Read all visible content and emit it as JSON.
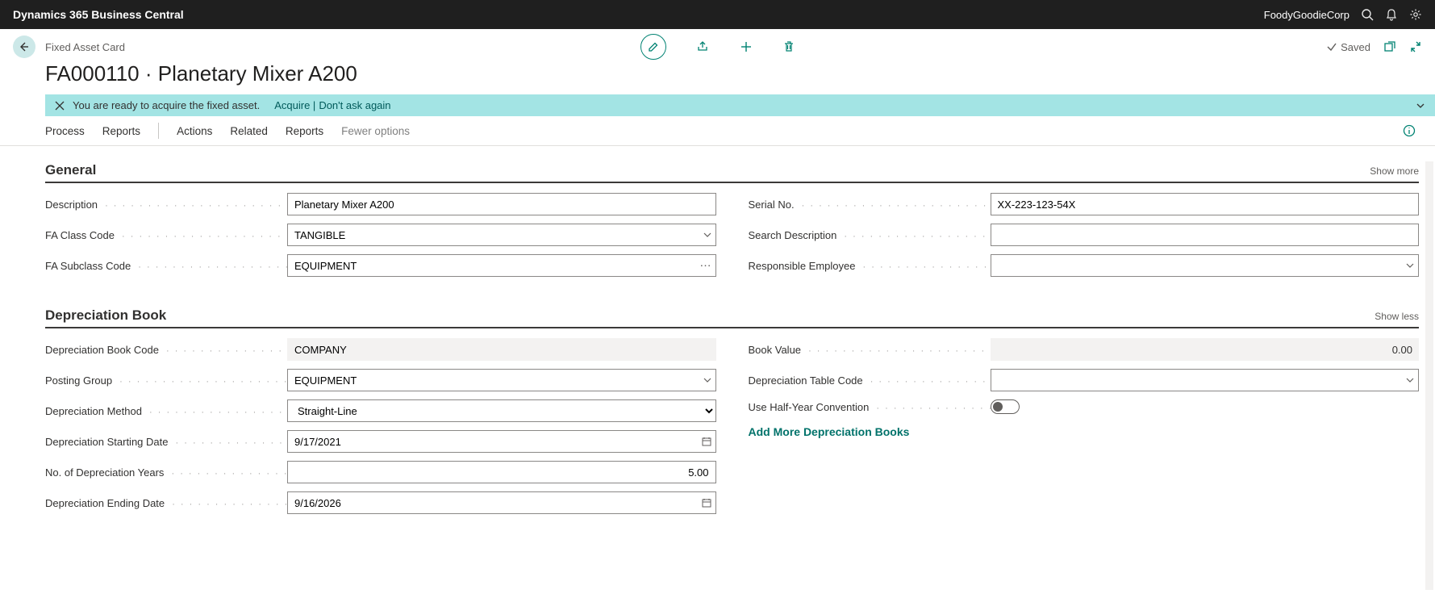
{
  "topbar": {
    "product": "Dynamics 365 Business Central",
    "company": "FoodyGoodieCorp"
  },
  "breadcrumb": "Fixed Asset Card",
  "saved_label": "Saved",
  "page_title": "FA000110 · Planetary Mixer A200",
  "notification": {
    "message": "You are ready to acquire the fixed asset.",
    "action1": "Acquire",
    "action2": "Don't ask again"
  },
  "toolbar": {
    "items": [
      "Process",
      "Reports"
    ],
    "items2": [
      "Actions",
      "Related",
      "Reports"
    ],
    "fewer": "Fewer options"
  },
  "sections": {
    "general": {
      "title": "General",
      "toggle": "Show more",
      "fields": {
        "description": {
          "label": "Description",
          "value": "Planetary Mixer A200"
        },
        "fa_class_code": {
          "label": "FA Class Code",
          "value": "TANGIBLE"
        },
        "fa_subclass_code": {
          "label": "FA Subclass Code",
          "value": "EQUIPMENT"
        },
        "serial_no": {
          "label": "Serial No.",
          "value": "XX-223-123-54X"
        },
        "search_description": {
          "label": "Search Description",
          "value": ""
        },
        "responsible_employee": {
          "label": "Responsible Employee",
          "value": ""
        }
      }
    },
    "depreciation": {
      "title": "Depreciation Book",
      "toggle": "Show less",
      "fields": {
        "depr_book_code": {
          "label": "Depreciation Book Code",
          "value": "COMPANY"
        },
        "posting_group": {
          "label": "Posting Group",
          "value": "EQUIPMENT"
        },
        "depr_method": {
          "label": "Depreciation Method",
          "value": "Straight-Line"
        },
        "depr_start_date": {
          "label": "Depreciation Starting Date",
          "value": "9/17/2021"
        },
        "no_depr_years": {
          "label": "No. of Depreciation Years",
          "value": "5.00"
        },
        "depr_end_date": {
          "label": "Depreciation Ending Date",
          "value": "9/16/2026"
        },
        "book_value": {
          "label": "Book Value",
          "value": "0.00"
        },
        "depr_table_code": {
          "label": "Depreciation Table Code",
          "value": ""
        },
        "half_year": {
          "label": "Use Half-Year Convention",
          "on": false
        }
      },
      "add_more": "Add More Depreciation Books"
    }
  }
}
